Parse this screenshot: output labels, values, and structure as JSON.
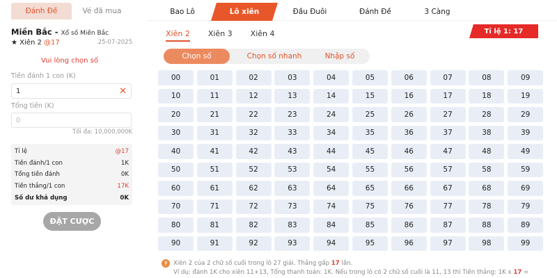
{
  "left": {
    "tabs": [
      "Đánh Đề",
      "Vé đã mua"
    ],
    "region": "Miền Bắc -",
    "lottery": "Xổ số Miền Bắc",
    "star": "★",
    "bet_type": "Xiên 2",
    "odds": "@17",
    "date": "25-07-2025",
    "warning": "Vui lòng chọn số",
    "stake_label": "Tiền đánh 1 con (K)",
    "stake_value": "1",
    "total_label": "Tổng tiền (K)",
    "total_placeholder": "0",
    "max": "Tối đa: 10,000,000K",
    "summary": [
      {
        "label": "Tỉ lệ",
        "value": "@17"
      },
      {
        "label": "Tiền đánh/1 con",
        "value": "1K"
      },
      {
        "label": "Tổng tiền đánh",
        "value": "0K"
      },
      {
        "label": "Tiền thắng/1 con",
        "value": "17K"
      },
      {
        "label": "Số dư khả dụng",
        "value": "0K"
      }
    ],
    "bet_button": "ĐẶT CƯỢC"
  },
  "main_tabs": [
    "Bao Lô",
    "Lô xiên",
    "Đầu Đuôi",
    "Đánh Đề",
    "3 Càng"
  ],
  "active_main_tab": "Lô xiên",
  "sub_tabs": [
    "Xiên 2",
    "Xiên 3",
    "Xiên 4"
  ],
  "active_sub_tab": "Xiên 2",
  "ratio": "Tỉ lệ 1: 17",
  "modes": [
    "Chọn số",
    "Chọn số nhanh",
    "Nhập số"
  ],
  "active_mode": "Chọn số",
  "numbers": [
    "00",
    "01",
    "02",
    "03",
    "04",
    "05",
    "06",
    "07",
    "08",
    "09",
    "10",
    "11",
    "12",
    "13",
    "14",
    "15",
    "16",
    "17",
    "18",
    "19",
    "20",
    "21",
    "22",
    "23",
    "24",
    "25",
    "26",
    "27",
    "28",
    "29",
    "30",
    "31",
    "32",
    "33",
    "34",
    "35",
    "36",
    "37",
    "38",
    "39",
    "40",
    "41",
    "42",
    "43",
    "44",
    "45",
    "46",
    "47",
    "48",
    "49",
    "50",
    "51",
    "52",
    "53",
    "54",
    "55",
    "56",
    "57",
    "58",
    "59",
    "60",
    "61",
    "62",
    "63",
    "64",
    "65",
    "66",
    "67",
    "68",
    "69",
    "70",
    "71",
    "72",
    "73",
    "74",
    "75",
    "76",
    "77",
    "78",
    "79",
    "80",
    "81",
    "82",
    "83",
    "84",
    "85",
    "86",
    "87",
    "88",
    "89",
    "90",
    "91",
    "92",
    "93",
    "94",
    "95",
    "96",
    "97",
    "98",
    "99"
  ],
  "note": {
    "icon": "?",
    "line1_prefix": "Xiên 2 của 2 chữ số cuối trong lô 27 giải. Thắng gấp",
    "line1_highlight": "17",
    "line1_suffix": "lần.",
    "line2_prefix": "Ví dụ: đánh 1K cho xiên 11+13, Tổng thanh toán: 1K. Nếu trong lô có 2 chữ số cuối là 11, 13 thì Tiền thắng: 1K x",
    "line2_highlight": "17",
    "line2_suffix": "="
  },
  "colors": {
    "accent": "#e8572a",
    "ratio_red": "#e52a28",
    "grid_cell": "#e9eef6",
    "button_disabled": "#a7a7a7"
  }
}
